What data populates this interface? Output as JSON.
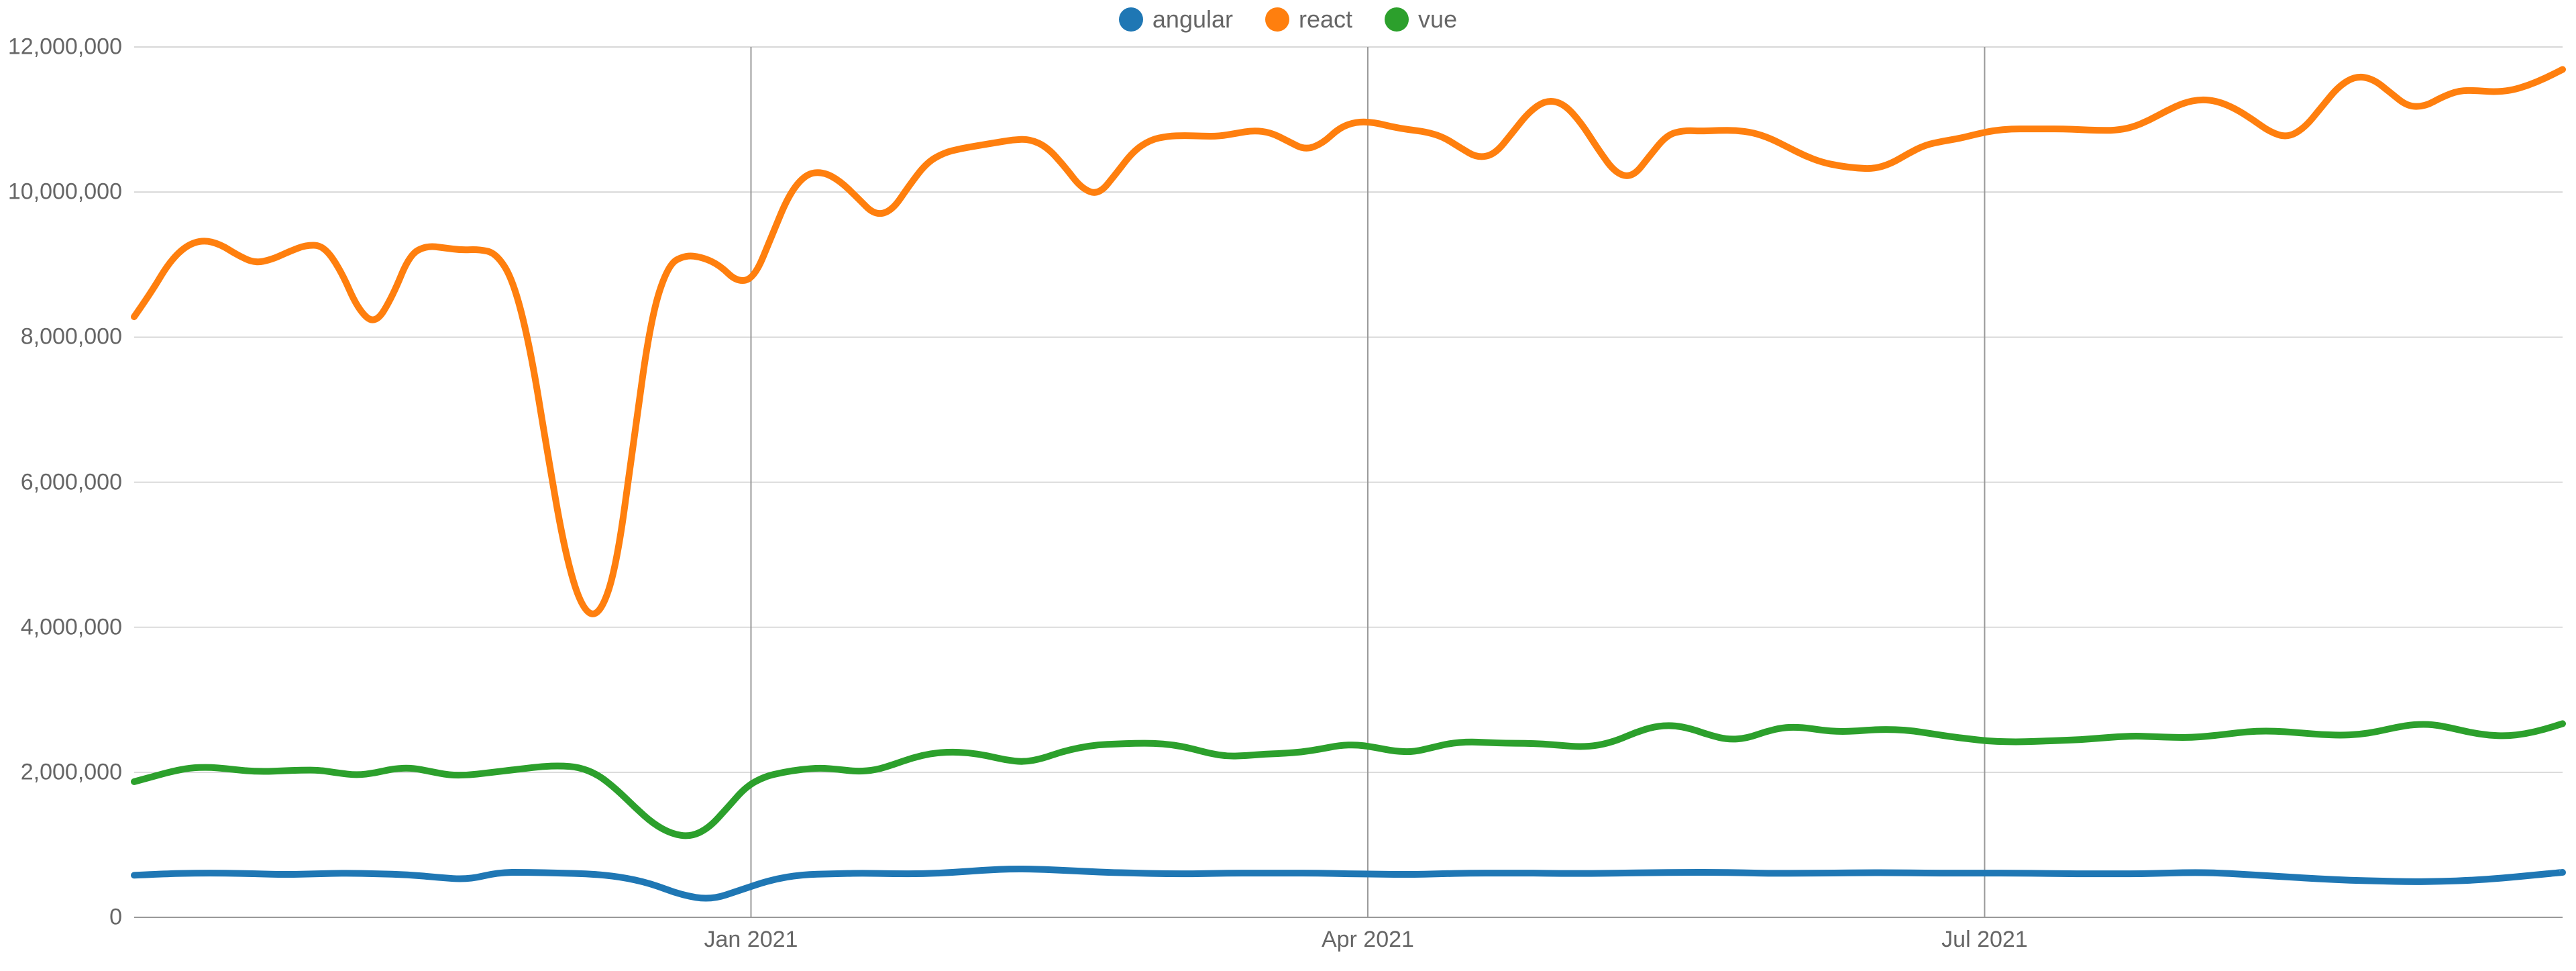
{
  "legend": [
    {
      "name": "angular",
      "color": "#1f77b4"
    },
    {
      "name": "react",
      "color": "#ff7f0e"
    },
    {
      "name": "vue",
      "color": "#2ca02c"
    }
  ],
  "chart_data": {
    "type": "line",
    "title": "",
    "xlabel": "",
    "ylabel": "",
    "ylim": [
      0,
      12000000
    ],
    "y_ticks": [
      0,
      2000000,
      4000000,
      6000000,
      8000000,
      10000000,
      12000000
    ],
    "x_tick_labels": [
      "Jan 2021",
      "Apr 2021",
      "Jul 2021"
    ],
    "x_tick_positions": [
      0.254,
      0.508,
      0.762
    ],
    "x_range_fraction": [
      0.0,
      1.0
    ],
    "series": [
      {
        "name": "angular",
        "color": "#1f77b4",
        "values": [
          580000,
          600000,
          610000,
          610000,
          600000,
          590000,
          600000,
          610000,
          600000,
          590000,
          550000,
          520000,
          620000,
          620000,
          610000,
          600000,
          560000,
          470000,
          310000,
          240000,
          380000,
          520000,
          590000,
          600000,
          610000,
          600000,
          600000,
          620000,
          650000,
          670000,
          660000,
          640000,
          620000,
          610000,
          600000,
          600000,
          610000,
          610000,
          610000,
          610000,
          600000,
          595000,
          590000,
          600000,
          610000,
          610000,
          610000,
          605000,
          605000,
          610000,
          615000,
          620000,
          620000,
          615000,
          605000,
          610000,
          610000,
          615000,
          615000,
          610000,
          610000,
          610000,
          610000,
          605000,
          600000,
          600000,
          600000,
          610000,
          620000,
          605000,
          580000,
          555000,
          530000,
          510000,
          500000,
          490000,
          495000,
          510000,
          540000,
          580000,
          620000
        ]
      },
      {
        "name": "react",
        "color": "#ff7f0e",
        "values": [
          8280000,
          8620000,
          9020000,
          9260000,
          9340000,
          9280000,
          9130000,
          9020000,
          9070000,
          9180000,
          9270000,
          9260000,
          8920000,
          8380000,
          8170000,
          8560000,
          9140000,
          9260000,
          9230000,
          9200000,
          9210000,
          9160000,
          8790000,
          7850000,
          6400000,
          5040000,
          4240000,
          4140000,
          4820000,
          6570000,
          8260000,
          9000000,
          9130000,
          9100000,
          8990000,
          8760000,
          8810000,
          9380000,
          9960000,
          10250000,
          10280000,
          10150000,
          9920000,
          9680000,
          9740000,
          10090000,
          10400000,
          10540000,
          10600000,
          10640000,
          10680000,
          10720000,
          10730000,
          10620000,
          10360000,
          10050000,
          9960000,
          10250000,
          10560000,
          10720000,
          10770000,
          10780000,
          10770000,
          10770000,
          10810000,
          10850000,
          10820000,
          10700000,
          10580000,
          10670000,
          10890000,
          10970000,
          10960000,
          10900000,
          10860000,
          10830000,
          10760000,
          10610000,
          10470000,
          10520000,
          10810000,
          11110000,
          11270000,
          11220000,
          10960000,
          10590000,
          10260000,
          10200000,
          10500000,
          10790000,
          10850000,
          10840000,
          10850000,
          10850000,
          10820000,
          10740000,
          10620000,
          10500000,
          10410000,
          10360000,
          10330000,
          10320000,
          10390000,
          10530000,
          10650000,
          10700000,
          10740000,
          10800000,
          10850000,
          10870000,
          10870000,
          10870000,
          10870000,
          10860000,
          10850000,
          10850000,
          10890000,
          10990000,
          11120000,
          11230000,
          11280000,
          11250000,
          11150000,
          11000000,
          10830000,
          10750000,
          10880000,
          11170000,
          11460000,
          11600000,
          11560000,
          11370000,
          11180000,
          11180000,
          11310000,
          11400000,
          11400000,
          11380000,
          11400000,
          11470000,
          11570000,
          11690000
        ]
      },
      {
        "name": "vue",
        "color": "#2ca02c",
        "values": [
          1870000,
          1940000,
          2010000,
          2060000,
          2070000,
          2050000,
          2020000,
          2010000,
          2020000,
          2030000,
          2030000,
          1990000,
          1960000,
          1990000,
          2050000,
          2060000,
          2010000,
          1960000,
          1960000,
          1990000,
          2020000,
          2050000,
          2080000,
          2090000,
          2070000,
          1970000,
          1770000,
          1520000,
          1290000,
          1150000,
          1110000,
          1230000,
          1510000,
          1800000,
          1940000,
          2000000,
          2040000,
          2060000,
          2040000,
          2010000,
          2030000,
          2110000,
          2200000,
          2260000,
          2280000,
          2270000,
          2230000,
          2170000,
          2140000,
          2190000,
          2280000,
          2340000,
          2380000,
          2390000,
          2400000,
          2400000,
          2380000,
          2330000,
          2260000,
          2220000,
          2230000,
          2250000,
          2260000,
          2280000,
          2320000,
          2370000,
          2380000,
          2340000,
          2290000,
          2280000,
          2340000,
          2400000,
          2420000,
          2410000,
          2400000,
          2400000,
          2390000,
          2370000,
          2350000,
          2370000,
          2440000,
          2550000,
          2630000,
          2650000,
          2600000,
          2510000,
          2450000,
          2470000,
          2560000,
          2620000,
          2620000,
          2580000,
          2560000,
          2570000,
          2590000,
          2590000,
          2570000,
          2530000,
          2490000,
          2460000,
          2430000,
          2420000,
          2420000,
          2430000,
          2440000,
          2450000,
          2470000,
          2490000,
          2500000,
          2490000,
          2480000,
          2480000,
          2500000,
          2530000,
          2560000,
          2570000,
          2560000,
          2540000,
          2520000,
          2510000,
          2520000,
          2560000,
          2620000,
          2660000,
          2660000,
          2610000,
          2550000,
          2510000,
          2500000,
          2530000,
          2590000,
          2670000
        ]
      }
    ]
  }
}
